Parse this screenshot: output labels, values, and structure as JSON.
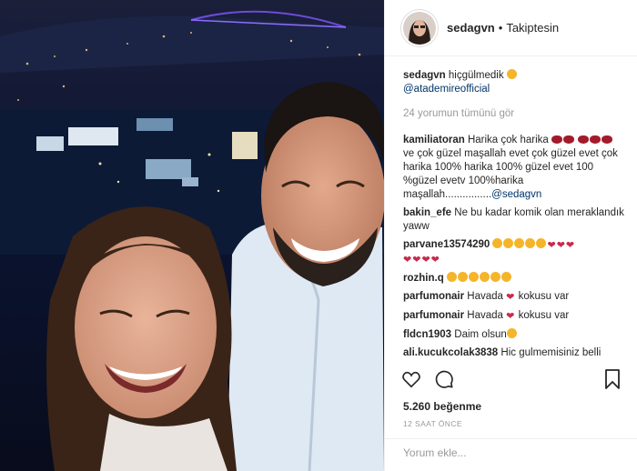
{
  "header": {
    "username": "sedagvn",
    "separator": "•",
    "follow_label": "Takiptesin"
  },
  "caption": {
    "username": "sedagvn",
    "text": "hiçgülmedik",
    "mention": "@atademireofficial"
  },
  "view_all_comments": "24 yorumun tümünü gör",
  "comments": [
    {
      "username": "kamiliatoran",
      "text": "Harika çok harika",
      "text2": "ve çok güzel maşallah evet çok güzel evet çok harika 100% harika 100% güzel evet 100 %güzel evetv 100%harika maşallah................",
      "mention": "@sedagvn"
    },
    {
      "username": "bakin_efe",
      "text": "Ne bu kadar komik olan meraklandık yaww"
    },
    {
      "username": "parvane13574290",
      "text": ""
    },
    {
      "username": "rozhin.q",
      "text": ""
    },
    {
      "username": "parfumonair",
      "text": "Havada",
      "text2": "kokusu var"
    },
    {
      "username": "parfumonair",
      "text": "Havada",
      "text2": "kokusu var"
    },
    {
      "username": "fldcn1903",
      "text": "Daim olsun"
    },
    {
      "username": "ali.kucukcolak3838",
      "text": "Hic gulmemisiniz belli"
    }
  ],
  "likes": "5.260 beğenme",
  "time": "12 SAAT ÖNCE",
  "add_comment_placeholder": "Yorum ekle...",
  "icons": [
    "heart-icon",
    "comment-icon",
    "bookmark-icon"
  ],
  "colors": {
    "text": "#262626",
    "muted": "#999999",
    "link": "#003569",
    "border": "#efefef"
  }
}
